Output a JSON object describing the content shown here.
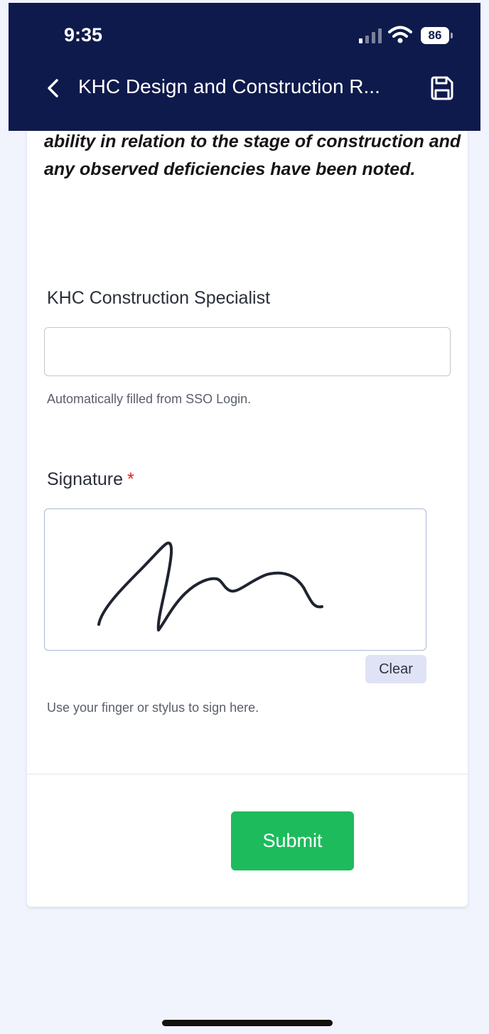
{
  "status_bar": {
    "time": "9:35",
    "battery": "86",
    "icons": [
      "signal-icon",
      "wifi-icon",
      "battery-icon"
    ]
  },
  "header": {
    "title": "KHC Design and Construction R...",
    "back_icon": "chevron-left-icon",
    "save_icon": "save-icon"
  },
  "form": {
    "statement": "ability in relation to the stage of construction and any observed deficiencies have been noted.",
    "specialist": {
      "label": "KHC Construction Specialist",
      "value": "",
      "help": "Automatically filled from SSO Login."
    },
    "signature": {
      "label": "Signature",
      "required_mark": "*",
      "clear_label": "Clear",
      "help": "Use your finger or stylus to sign here."
    },
    "submit_label": "Submit"
  },
  "colors": {
    "header_bg": "#0e1a4c",
    "page_bg": "#f1f3fd",
    "submit_bg": "#1dbb5c",
    "required": "#e02424",
    "clear_bg": "#dfe3f5"
  }
}
